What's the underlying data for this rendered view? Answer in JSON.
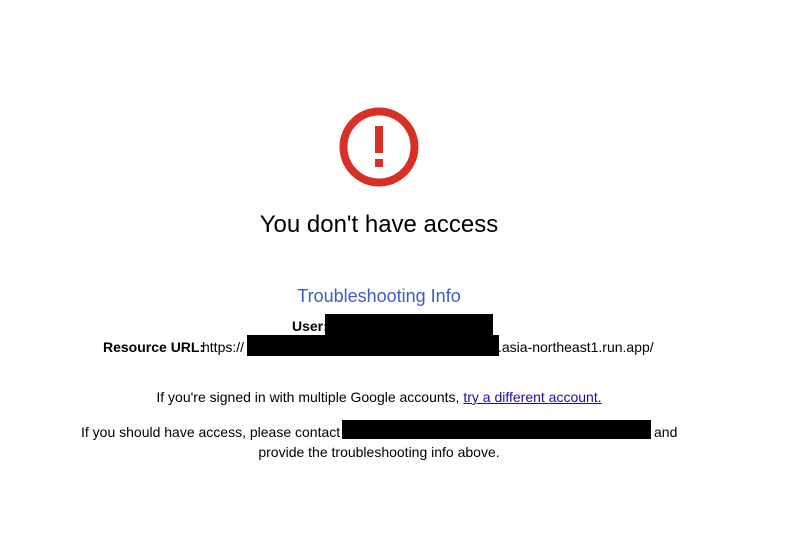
{
  "icon": "exclamation-circle-icon",
  "colors": {
    "icon_red": "#d93025",
    "heading_blue": "#3c5bc4",
    "link_blue": "#1a0dab",
    "redaction": "#000000"
  },
  "title": "You don't have access",
  "troubleshooting": {
    "heading": "Troubleshooting Info",
    "user_label": "User:",
    "resource_label": "Resource URL:",
    "resource_prefix": "https://",
    "resource_suffix": ".asia-northeast1.run.app/"
  },
  "accounts_message": {
    "text": "If you're signed in with multiple Google accounts, ",
    "link": "try a different account."
  },
  "access_message": {
    "line1_start": "If you should have access, please contact",
    "line1_end": "and",
    "line2": "provide the troubleshooting info above."
  }
}
